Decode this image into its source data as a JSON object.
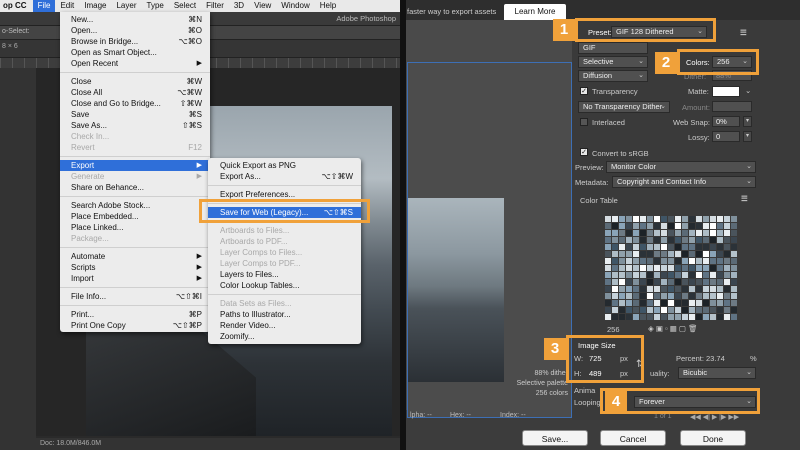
{
  "photoshop": {
    "app_name": "op CC",
    "menubar": [
      "File",
      "Edit",
      "Image",
      "Layer",
      "Type",
      "Select",
      "Filter",
      "3D",
      "View",
      "Window",
      "Help"
    ],
    "window_title": "Adobe Photoshop",
    "options_label": "o-Select:",
    "tab_label": "8 × 6",
    "status_text": "Doc: 18.0M/846.0M"
  },
  "file_menu": {
    "items": [
      {
        "label": "New...",
        "shortcut": "⌘N"
      },
      {
        "label": "Open...",
        "shortcut": "⌘O"
      },
      {
        "label": "Browse in Bridge...",
        "shortcut": "⌥⌘O"
      },
      {
        "label": "Open as Smart Object...",
        "shortcut": ""
      },
      {
        "label": "Open Recent",
        "shortcut": "▶"
      },
      {
        "label": "Close",
        "shortcut": "⌘W"
      },
      {
        "label": "Close All",
        "shortcut": "⌥⌘W"
      },
      {
        "label": "Close and Go to Bridge...",
        "shortcut": "⇧⌘W"
      },
      {
        "label": "Save",
        "shortcut": "⌘S"
      },
      {
        "label": "Save As...",
        "shortcut": "⇧⌘S"
      },
      {
        "label": "Check In...",
        "shortcut": ""
      },
      {
        "label": "Revert",
        "shortcut": "F12"
      },
      {
        "label": "Export",
        "shortcut": "▶"
      },
      {
        "label": "Generate",
        "shortcut": "▶"
      },
      {
        "label": "Share on Behance...",
        "shortcut": ""
      },
      {
        "label": "Search Adobe Stock...",
        "shortcut": ""
      },
      {
        "label": "Place Embedded...",
        "shortcut": ""
      },
      {
        "label": "Place Linked...",
        "shortcut": ""
      },
      {
        "label": "Package...",
        "shortcut": ""
      },
      {
        "label": "Automate",
        "shortcut": "▶"
      },
      {
        "label": "Scripts",
        "shortcut": "▶"
      },
      {
        "label": "Import",
        "shortcut": "▶"
      },
      {
        "label": "File Info...",
        "shortcut": "⌥⇧⌘I"
      },
      {
        "label": "Print...",
        "shortcut": "⌘P"
      },
      {
        "label": "Print One Copy",
        "shortcut": "⌥⇧⌘P"
      }
    ]
  },
  "export_menu": {
    "items": [
      {
        "label": "Quick Export as PNG",
        "shortcut": ""
      },
      {
        "label": "Export As...",
        "shortcut": "⌥⇧⌘W"
      },
      {
        "label": "Export Preferences...",
        "shortcut": ""
      },
      {
        "label": "Save for Web (Legacy)...",
        "shortcut": "⌥⇧⌘S"
      },
      {
        "label": "Artboards to Files...",
        "shortcut": ""
      },
      {
        "label": "Artboards to PDF...",
        "shortcut": ""
      },
      {
        "label": "Layer Comps to Files...",
        "shortcut": ""
      },
      {
        "label": "Layer Comps to PDF...",
        "shortcut": ""
      },
      {
        "label": "Layers to Files...",
        "shortcut": ""
      },
      {
        "label": "Color Lookup Tables...",
        "shortcut": ""
      },
      {
        "label": "Data Sets as Files...",
        "shortcut": ""
      },
      {
        "label": "Paths to Illustrator...",
        "shortcut": ""
      },
      {
        "label": "Render Video...",
        "shortcut": ""
      },
      {
        "label": "Zoomify...",
        "shortcut": ""
      }
    ]
  },
  "save_for_web": {
    "tip": "faster way to export assets",
    "learn_more": "Learn More",
    "preset_label": "Preset:",
    "preset_value": "GIF 128 Dithered",
    "format_value": "GIF",
    "reduction_value": "Selective",
    "colors_label": "Colors:",
    "colors_value": "256",
    "dither_algo_value": "Diffusion",
    "dither_label": "Dither:",
    "dither_value": "88%",
    "transparency_label": "Transparency",
    "matte_label": "Matte:",
    "transparency_dither_value": "No Transparency Dither",
    "amount_label": "Amount:",
    "interlaced_label": "Interlaced",
    "web_snap_label": "Web Snap:",
    "web_snap_value": "0%",
    "lossy_label": "Lossy:",
    "lossy_value": "0",
    "convert_srgb_label": "Convert to sRGB",
    "preview_label": "Preview:",
    "preview_value": "Monitor Color",
    "metadata_label": "Metadata:",
    "metadata_value": "Copyright and Contact Info",
    "color_table_label": "Color Table",
    "color_count": "256",
    "image_size_label": "Image Size",
    "width_label": "W:",
    "width_value": "725",
    "height_label": "H:",
    "height_value": "489",
    "unit": "px",
    "percent_label": "Percent:",
    "percent_value": "23.74",
    "percent_unit": "%",
    "quality_label": "uality:",
    "quality_value": "Bicubic",
    "animation_label": "Anima",
    "looping_label": "Looping",
    "looping_value": "Forever",
    "frame_counter": "1 of 1",
    "preview_info": [
      "88% dither",
      "Selective palette",
      "256 colors"
    ],
    "alpha_label": "lpha: --",
    "hex_label": "Hex: --",
    "index_label": "Index: --",
    "save_button": "Save...",
    "cancel_button": "Cancel",
    "done_button": "Done"
  },
  "callouts": [
    "1",
    "2",
    "3",
    "4"
  ],
  "colors": {
    "accent_orange": "#f0a13a",
    "menu_highlight": "#2f6fd9",
    "bg_blue_gray": "#5b6e78"
  }
}
